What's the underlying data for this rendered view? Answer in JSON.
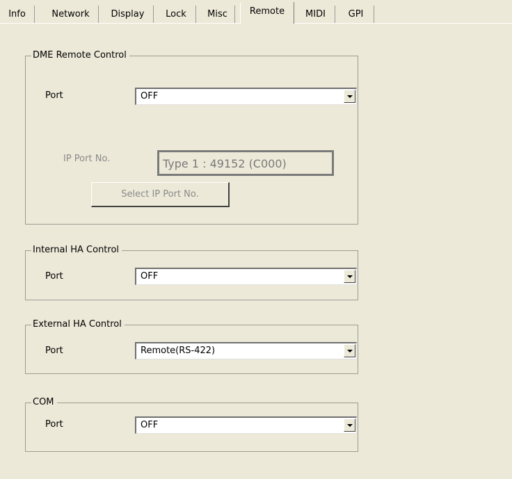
{
  "tabs": [
    {
      "label": "Info",
      "active": false
    },
    {
      "label": "Network",
      "active": false
    },
    {
      "label": "Display",
      "active": false
    },
    {
      "label": "Lock",
      "active": false
    },
    {
      "label": "Misc",
      "active": false
    },
    {
      "label": "Remote",
      "active": true
    },
    {
      "label": "MIDI",
      "active": false
    },
    {
      "label": "GPI",
      "active": false
    }
  ],
  "dme": {
    "title": "DME Remote Control",
    "port_label": "Port",
    "port_value": "OFF",
    "ip_port_label": "IP Port No.",
    "ip_port_value": "Type 1 : 49152 (C000)",
    "select_button": "Select IP Port No."
  },
  "internal_ha": {
    "title": "Internal HA Control",
    "port_label": "Port",
    "port_value": "OFF"
  },
  "external_ha": {
    "title": "External HA Control",
    "port_label": "Port",
    "port_value": "Remote(RS-422)"
  },
  "com": {
    "title": "COM",
    "port_label": "Port",
    "port_value": "OFF"
  }
}
